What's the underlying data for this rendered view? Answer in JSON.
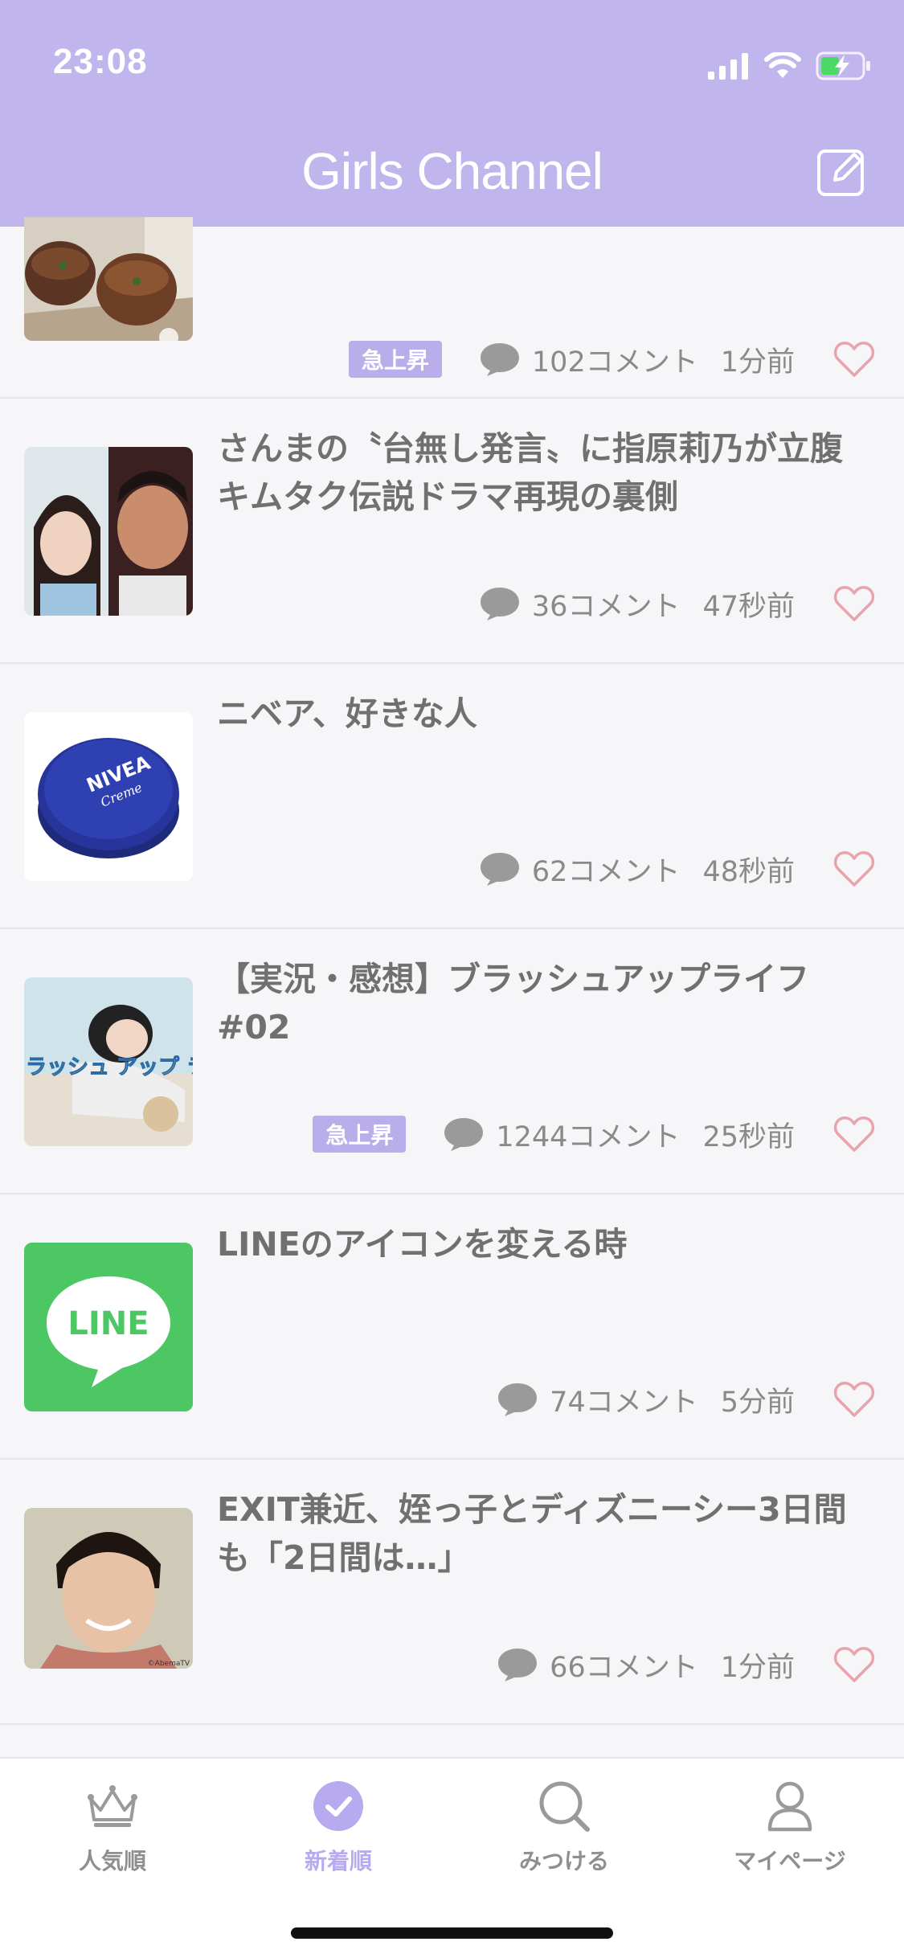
{
  "status": {
    "time": "23:08"
  },
  "header": {
    "title": "Girls Channel",
    "compose_icon": "compose-icon"
  },
  "colors": {
    "accent": "#c1b5ee",
    "badge": "#b9aee9",
    "heart": "#e8a3ac",
    "text": "#707070"
  },
  "topics": [
    {
      "title": "",
      "badge": "急上昇",
      "comments": "102コメント",
      "time": "1分前",
      "thumb": "takoyaki"
    },
    {
      "title": "さんまの〝台無し発言〟に指原莉乃が立腹　キムタク伝説ドラマ再現の裏側",
      "badge": "",
      "comments": "36コメント",
      "time": "47秒前",
      "thumb": "people"
    },
    {
      "title": "ニベア、好きな人",
      "badge": "",
      "comments": "62コメント",
      "time": "48秒前",
      "thumb": "nivea"
    },
    {
      "title": "【実況・感想】ブラッシュアップライフ #02",
      "badge": "急上昇",
      "comments": "1244コメント",
      "time": "25秒前",
      "thumb": "drama"
    },
    {
      "title": "LINEのアイコンを変える時",
      "badge": "",
      "comments": "74コメント",
      "time": "5分前",
      "thumb": "line"
    },
    {
      "title": "EXIT兼近、姪っ子とディズニーシー3日間も「2日間は…」",
      "badge": "",
      "comments": "66コメント",
      "time": "1分前",
      "thumb": "person"
    }
  ],
  "thumb_text": {
    "nivea": "NIVEA",
    "nivea_sub": "Creme",
    "line": "LINE",
    "drama": "ラッシュ アップ ライフ",
    "credit": "©AbemaTV"
  },
  "tabs": [
    {
      "label": "人気順",
      "icon": "crown-icon"
    },
    {
      "label": "新着順",
      "icon": "check-circle-icon"
    },
    {
      "label": "みつける",
      "icon": "search-icon"
    },
    {
      "label": "マイページ",
      "icon": "person-icon"
    }
  ]
}
